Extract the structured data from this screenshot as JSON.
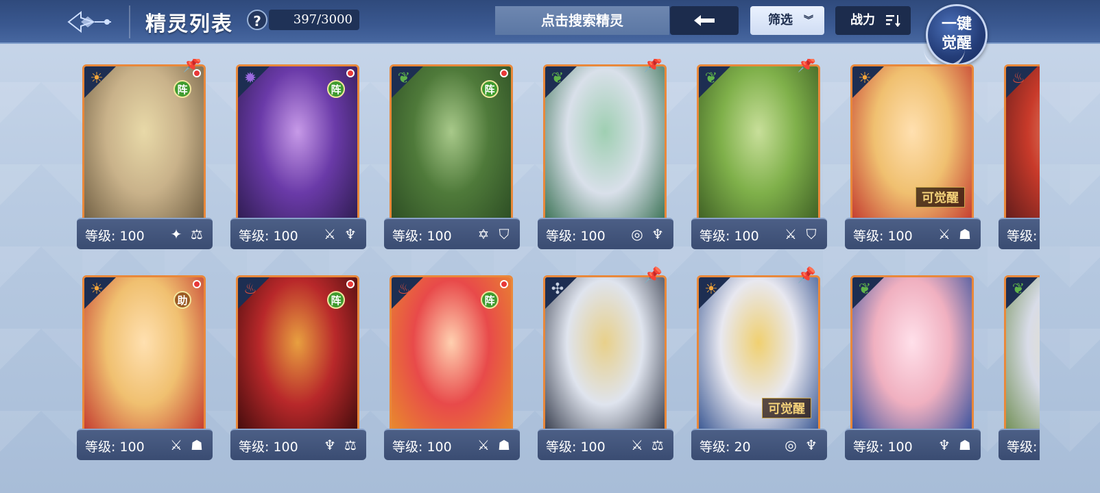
{
  "header": {
    "title": "精灵列表",
    "help": "?",
    "count": "397/3000",
    "search_placeholder": "点击搜索精灵",
    "filter_label": "筛选",
    "sort_label": "战力",
    "awaken_line1": "一键",
    "awaken_line2": "觉醒"
  },
  "colors": {
    "frame": "#e9883a",
    "accent_dark": "#1c2c4d",
    "level_bar": "#3a4c72"
  },
  "cards": [
    {
      "level": "等级: 100",
      "element": "light",
      "badge": "阵",
      "badge_color": "green",
      "pin": true,
      "dot": true,
      "awake": "",
      "art": [
        "#c9b28a",
        "#6b5a3f",
        "#e8d9a8"
      ],
      "skills": [
        "✦",
        "⚖"
      ]
    },
    {
      "level": "等级: 100",
      "element": "shadow",
      "badge": "阵",
      "badge_color": "green",
      "pin": false,
      "dot": true,
      "awake": "",
      "art": [
        "#6a3aa8",
        "#2a1a4a",
        "#c79ae8"
      ],
      "skills": [
        "⚔",
        "♆"
      ]
    },
    {
      "level": "等级: 100",
      "element": "grass",
      "badge": "阵",
      "badge_color": "green",
      "pin": false,
      "dot": true,
      "awake": "",
      "art": [
        "#4f7a3a",
        "#2a4a22",
        "#a8c98a"
      ],
      "skills": [
        "✡",
        "⛉"
      ]
    },
    {
      "level": "等级: 100",
      "element": "grass",
      "badge": "",
      "badge_color": "",
      "pin": true,
      "dot": false,
      "awake": "",
      "art": [
        "#d9e0ea",
        "#2f6a4a",
        "#9fcfb2"
      ],
      "skills": [
        "◎",
        "♆"
      ]
    },
    {
      "level": "等级: 100",
      "element": "grass",
      "badge": "",
      "badge_color": "",
      "pin": true,
      "dot": false,
      "awake": "",
      "art": [
        "#7fb04a",
        "#3a5a22",
        "#c8df9a"
      ],
      "skills": [
        "⚔",
        "⛉"
      ]
    },
    {
      "level": "等级: 100",
      "element": "light",
      "badge": "",
      "badge_color": "",
      "pin": false,
      "dot": false,
      "awake": "可觉醒",
      "art": [
        "#f0c070",
        "#c0302a",
        "#ffe0b0"
      ],
      "skills": [
        "⚔",
        "☗"
      ]
    },
    {
      "level": "等级: 100",
      "element": "fire",
      "badge": "",
      "badge_color": "",
      "pin": false,
      "dot": false,
      "awake": "",
      "art": [
        "#c83a2a",
        "#5a1a1a",
        "#e89a7a"
      ],
      "skills": [
        "⚔",
        "⚖"
      ]
    },
    {
      "level": "等级: 100",
      "element": "light",
      "badge": "助",
      "badge_color": "brown",
      "pin": false,
      "dot": true,
      "awake": "",
      "art": [
        "#f0c070",
        "#c0302a",
        "#ffe0b0"
      ],
      "skills": [
        "⚔",
        "☗"
      ]
    },
    {
      "level": "等级: 100",
      "element": "fire",
      "badge": "阵",
      "badge_color": "green",
      "pin": false,
      "dot": true,
      "awake": "",
      "art": [
        "#b8282a",
        "#3a0a0a",
        "#e8a040"
      ],
      "skills": [
        "♆",
        "⚖"
      ]
    },
    {
      "level": "等级: 100",
      "element": "fire",
      "badge": "阵",
      "badge_color": "green",
      "pin": false,
      "dot": true,
      "awake": "",
      "art": [
        "#e84a4a",
        "#e8902a",
        "#ffd0b0"
      ],
      "skills": [
        "⚔",
        "☗"
      ]
    },
    {
      "level": "等级: 100",
      "element": "neutral",
      "badge": "",
      "badge_color": "",
      "pin": true,
      "dot": false,
      "awake": "",
      "art": [
        "#dfe4ee",
        "#2a3040",
        "#e8d08a"
      ],
      "skills": [
        "⚔",
        "⚖"
      ]
    },
    {
      "level": "等级: 20",
      "element": "light",
      "badge": "",
      "badge_color": "",
      "pin": true,
      "dot": false,
      "awake": "可觉醒",
      "art": [
        "#e8e8f0",
        "#2a4a8a",
        "#f0d070"
      ],
      "skills": [
        "◎",
        "♆"
      ]
    },
    {
      "level": "等级: 100",
      "element": "grass",
      "badge": "",
      "badge_color": "",
      "pin": false,
      "dot": false,
      "awake": "",
      "art": [
        "#f0b0c0",
        "#2a4a9a",
        "#ffe0ea"
      ],
      "skills": [
        "♆",
        "☗"
      ]
    },
    {
      "level": "等级: 100",
      "element": "grass",
      "badge": "",
      "badge_color": "",
      "pin": false,
      "dot": false,
      "awake": "",
      "art": [
        "#d8dce8",
        "#6a8a4a",
        "#e8e0c0"
      ],
      "skills": [
        "⚔",
        "☗"
      ]
    }
  ]
}
